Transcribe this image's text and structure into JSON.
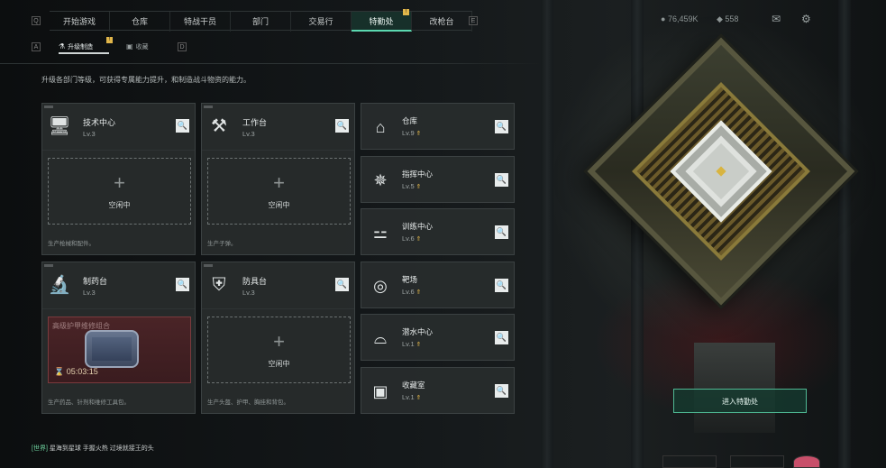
{
  "top_tabs": [
    {
      "label": "开始游戏"
    },
    {
      "label": "仓库"
    },
    {
      "label": "特战干员"
    },
    {
      "label": "部门"
    },
    {
      "label": "交易行"
    },
    {
      "label": "特勤处",
      "active": true,
      "badge": "!"
    },
    {
      "label": "改枪台"
    }
  ],
  "currency": {
    "coins": "76,459K",
    "gems": "558"
  },
  "subtabs": [
    {
      "label": "升级制造",
      "active": true,
      "badge": "!"
    },
    {
      "label": "收藏"
    }
  ],
  "description": "升级各部门等级，可获得专属能力提升，和制造战斗物资的能力。",
  "panels": [
    {
      "name": "技术中心",
      "level": "Lv.3",
      "icon": "computer-icon",
      "slot": "空闲中",
      "footer": "生产枪械和配件。"
    },
    {
      "name": "工作台",
      "level": "Lv.3",
      "icon": "tools-icon",
      "slot": "空闲中",
      "footer": "生产子弹。"
    },
    {
      "name": "制药台",
      "level": "Lv.3",
      "icon": "microscope-icon",
      "craft_name": "高级护甲维修组合",
      "timer": "05:03:15",
      "footer": "生产药品、针剂和维修工具包。"
    },
    {
      "name": "防具台",
      "level": "Lv.3",
      "icon": "armor-icon",
      "slot": "空闲中",
      "footer": "生产头盔、护甲、胸挂和背包。"
    }
  ],
  "facilities": [
    {
      "name": "仓库",
      "level": "Lv.9",
      "icon": "warehouse-icon"
    },
    {
      "name": "指挥中心",
      "level": "Lv.5",
      "icon": "command-icon"
    },
    {
      "name": "训练中心",
      "level": "Lv.6",
      "icon": "dumbbell-icon"
    },
    {
      "name": "靶场",
      "level": "Lv.6",
      "icon": "target-icon"
    },
    {
      "name": "潜水中心",
      "level": "Lv.1",
      "icon": "diving-icon"
    },
    {
      "name": "收藏室",
      "level": "Lv.1",
      "icon": "collection-icon"
    }
  ],
  "enter_button": "进入特勤处",
  "chat": {
    "tag": "[世界]",
    "text": "星海到星球  手握火热  过境就接王的头"
  },
  "colors": {
    "accent": "#5bd8b0",
    "upgrade": "#e4b84c",
    "crafting": "#4a2427"
  }
}
